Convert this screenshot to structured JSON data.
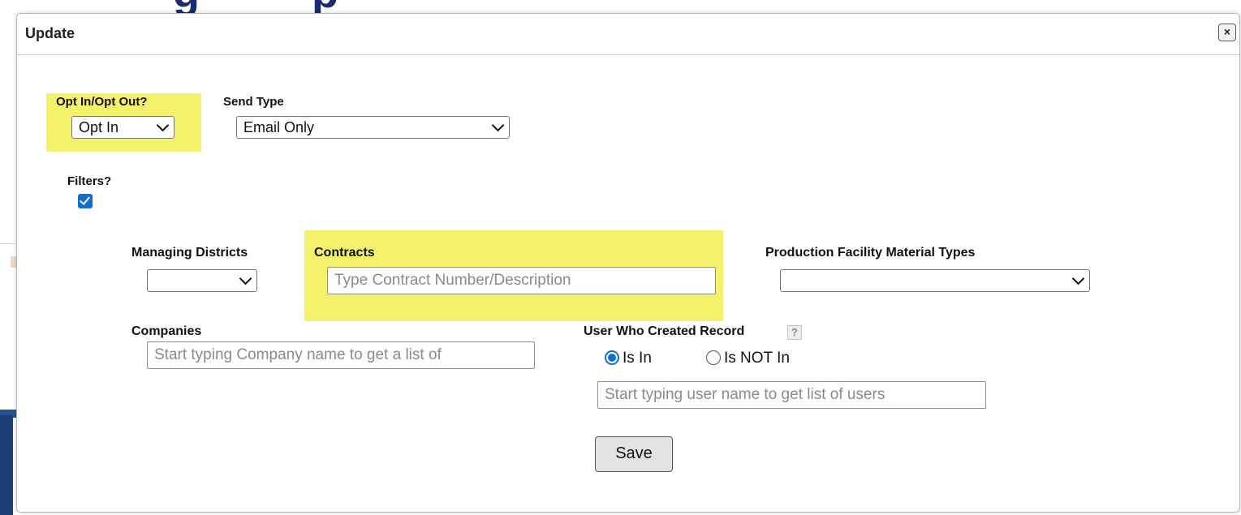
{
  "dialog": {
    "title": "Update",
    "close_glyph": "×"
  },
  "background": {
    "heading_fragments": [
      "g",
      "p"
    ]
  },
  "opt": {
    "label": "Opt In/Opt Out?",
    "value": "Opt In"
  },
  "send_type": {
    "label": "Send Type",
    "value": "Email Only"
  },
  "filters": {
    "label": "Filters?",
    "checked": true
  },
  "managing_districts": {
    "label": "Managing Districts",
    "value": ""
  },
  "contracts": {
    "label": "Contracts",
    "placeholder": "Type Contract Number/Description"
  },
  "production": {
    "label": "Production Facility Material Types",
    "value": ""
  },
  "companies": {
    "label": "Companies",
    "placeholder": "Start typing Company name to get a list of"
  },
  "created_by": {
    "label": "User Who Created Record",
    "help_glyph": "?",
    "option_in": "Is In",
    "option_not_in": "Is NOT In",
    "selected": "Is In",
    "placeholder": "Start typing user name to get list of users"
  },
  "actions": {
    "save_label": "Save"
  },
  "colors": {
    "highlight": "#f3f26a",
    "accent": "#0f6fd0",
    "background_panel": "#1c3e74"
  },
  "icons": [
    "close-icon",
    "chevron-down-icon",
    "checkbox-checked-icon",
    "help-icon",
    "radio-selected-icon",
    "radio-unselected-icon"
  ]
}
